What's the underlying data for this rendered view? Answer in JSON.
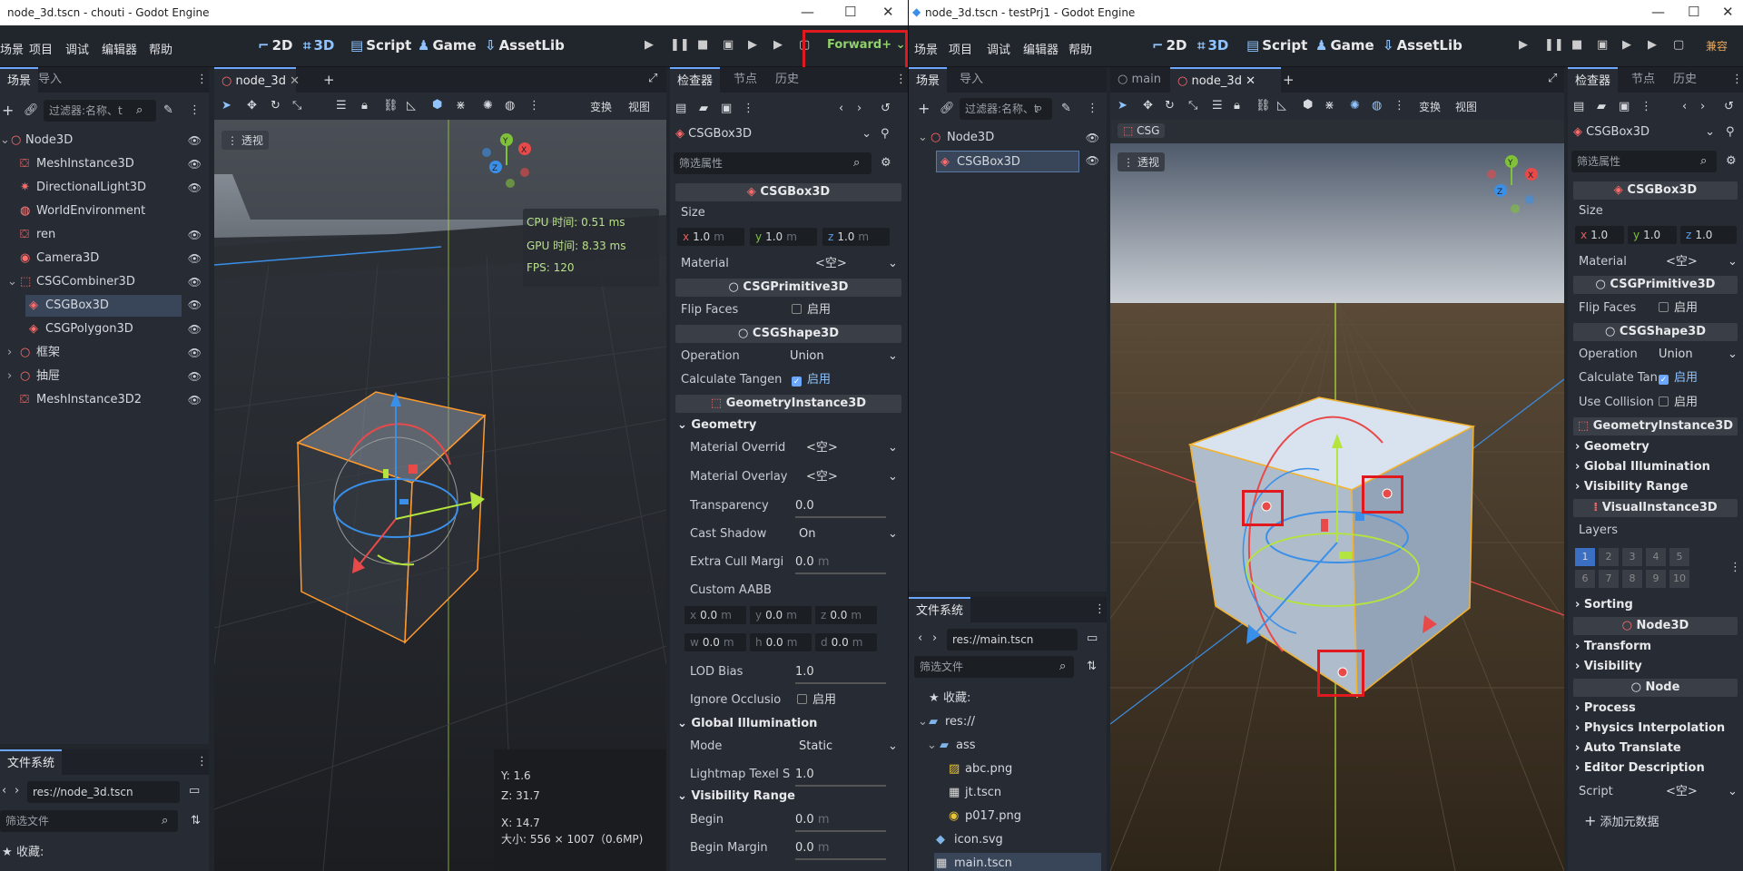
{
  "left": {
    "title": "node_3d.tscn - chouti - Godot Engine",
    "menu": [
      "场景",
      "项目",
      "调试",
      "编辑器",
      "帮助"
    ],
    "workspaces": [
      "2D",
      "3D",
      "Script",
      "Game",
      "AssetLib"
    ],
    "renderer": "Forward+",
    "dock_tabs": [
      "场景",
      "导入"
    ],
    "filter_placeholder": "过滤器:名称、t",
    "tree": [
      "Node3D",
      "MeshInstance3D",
      "DirectionalLight3D",
      "WorldEnvironment",
      "ren",
      "Camera3D",
      "CSGCombiner3D",
      "CSGBox3D",
      "CSGPolygon3D",
      "框架",
      "抽屉",
      "MeshInstance3D2"
    ],
    "fs_tab": "文件系统",
    "fs_path": "res://node_3d.tscn",
    "fs_filter": "筛选文件",
    "fs_favorites": "收藏:",
    "scene_tab": "node_3d",
    "view_btns": [
      "变换",
      "视图"
    ],
    "perspective": "透视",
    "stats": {
      "cpu": "CPU 时间: 0.51 ms",
      "gpu": "GPU 时间: 8.33 ms",
      "fps": "FPS: 120"
    },
    "coords": {
      "x": "X: 14.7",
      "y": "Y: 1.6",
      "z": "Z: 31.7",
      "size": "大小: 556 × 1007（0.6MP)"
    },
    "inspector_tabs": [
      "检查器",
      "节点",
      "历史"
    ],
    "node_type": "CSGBox3D",
    "filter_props": "筛选属性",
    "headers": {
      "csgbox": "CSGBox3D",
      "prim": "CSGPrimitive3D",
      "shape": "CSGShape3D",
      "geom": "GeometryInstance3D"
    },
    "size_label": "Size",
    "size": {
      "x": "1.0",
      "y": "1.0",
      "z": "1.0",
      "unit": "m"
    },
    "material": "Material",
    "empty": "<空>",
    "flip_faces": "Flip Faces",
    "enable": "启用",
    "operation": "Operation",
    "union": "Union",
    "calc_tangents": "Calculate Tangen",
    "geometry": "Geometry",
    "mat_override": "Material Overrid",
    "mat_overlay": "Material Overlay",
    "transparency": "Transparency",
    "transparency_val": "0.0",
    "cast_shadow": "Cast Shadow",
    "on": "On",
    "extra_cull": "Extra Cull Margi",
    "zero": "0.0",
    "custom_aabb": "Custom AABB",
    "aabb_axes": [
      "x",
      "y",
      "z",
      "w",
      "h",
      "d"
    ],
    "lod_bias": "LOD Bias",
    "one": "1.0",
    "ignore_occlusion": "Ignore Occlusio",
    "global_illum": "Global Illumination",
    "mode": "Mode",
    "static": "Static",
    "lightmap": "Lightmap Texel S",
    "vis_range": "Visibility Range",
    "begin": "Begin",
    "begin_margin": "Begin Margin"
  },
  "right": {
    "title": "node_3d.tscn - testPrj1 - Godot Engine",
    "scene_tabs": [
      "main",
      "node_3d"
    ],
    "tree": [
      "Node3D",
      "CSGBox3D"
    ],
    "csg_label": "CSG",
    "fs_path": "res://main.tscn",
    "files": [
      "收藏:",
      "res://",
      "ass",
      "abc.png",
      "jt.tscn",
      "p017.png",
      "icon.svg",
      "main.tscn"
    ],
    "renderer": "兼容",
    "use_collision": "Use Collision",
    "visual_instance": "VisualInstance3D",
    "layers": "Layers",
    "layer_nums": [
      "1",
      "2",
      "3",
      "4",
      "5",
      "6",
      "7",
      "8",
      "9",
      "10"
    ],
    "sections": [
      "Sorting",
      "Transform",
      "Visibility",
      "Process",
      "Physics Interpolation",
      "Auto Translate",
      "Editor Description"
    ],
    "node3d": "Node3D",
    "node": "Node",
    "script": "Script",
    "add_meta": "添加元数据",
    "calc_tangents": "Calculate Tan"
  },
  "colors": {
    "accent": "#6ba7ff",
    "highlight": "#e0191f",
    "selection": "#ff9a2e"
  }
}
